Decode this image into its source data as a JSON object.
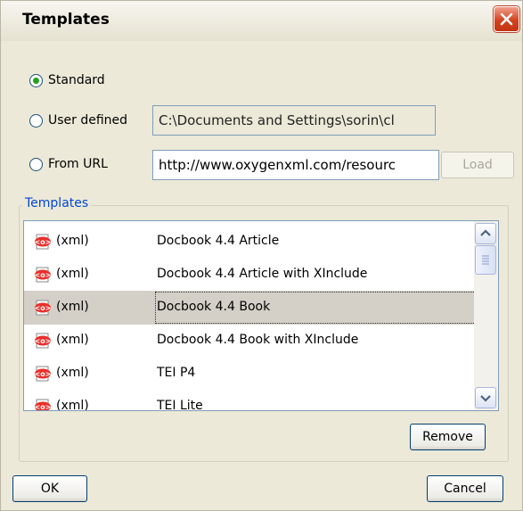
{
  "dialog": {
    "title": "Templates",
    "close_icon": "close-x-icon",
    "accent": "#d4411e"
  },
  "source": {
    "options": [
      {
        "label": "Standard",
        "checked": true
      },
      {
        "label": "User defined",
        "checked": false
      },
      {
        "label": "From URL",
        "checked": false
      }
    ],
    "user_defined_value": "C:\\Documents and Settings\\sorin\\cl",
    "url_value": "http://www.oxygenxml.com/resourc",
    "load_label": "Load"
  },
  "templates": {
    "group_label": "Templates",
    "row_icon": "xml-file-icon",
    "selected_index": 2,
    "items": [
      {
        "type": "(xml)",
        "name": "Docbook 4.4 Article"
      },
      {
        "type": "(xml)",
        "name": "Docbook 4.4 Article with XInclude"
      },
      {
        "type": "(xml)",
        "name": "Docbook 4.4 Book"
      },
      {
        "type": "(xml)",
        "name": "Docbook 4.4 Book with XInclude"
      },
      {
        "type": "(xml)",
        "name": "TEI P4"
      },
      {
        "type": "(xml)",
        "name": "TEI Lite"
      }
    ],
    "remove_label": "Remove"
  },
  "footer": {
    "ok_label": "OK",
    "cancel_label": "Cancel"
  }
}
